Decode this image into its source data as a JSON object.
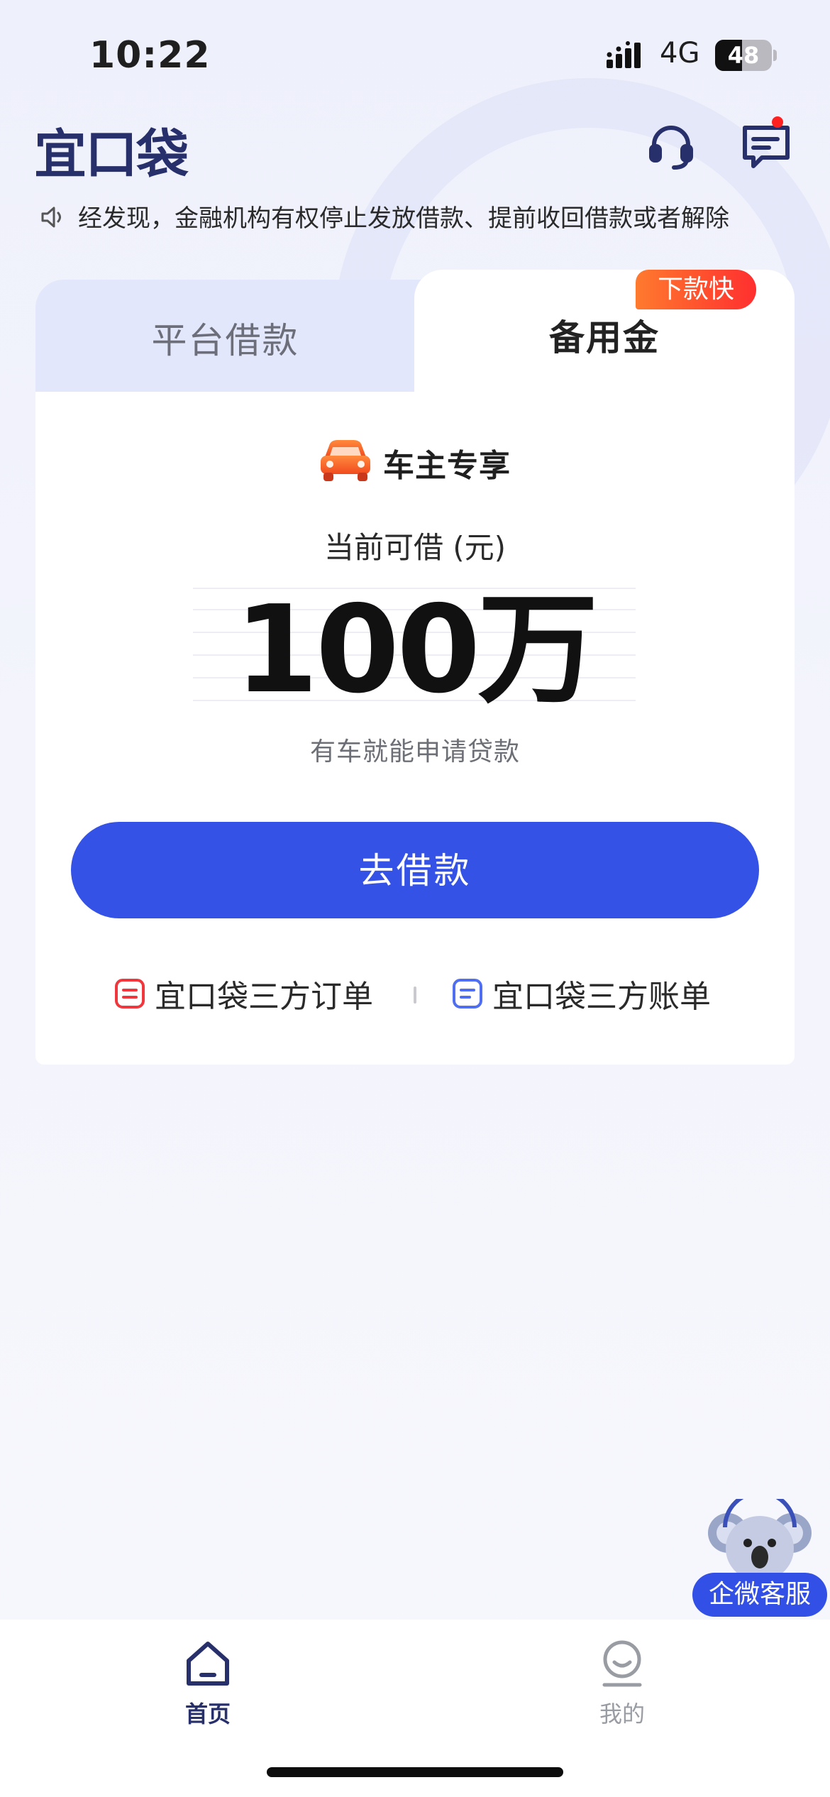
{
  "status_bar": {
    "time": "10:22",
    "network": "4G",
    "battery": "48",
    "battery_level": 0.48
  },
  "header": {
    "logo": "宜口袋",
    "icons": [
      "headset-icon",
      "message-icon"
    ],
    "has_unread": true
  },
  "notice": {
    "icon": "speaker-icon",
    "text": "经发现，金融机构有权停止发放借款、提前收回借款或者解除"
  },
  "tabs": [
    {
      "label": "平台借款",
      "active": false
    },
    {
      "label": "备用金",
      "active": true,
      "badge": "下款快"
    }
  ],
  "offer": {
    "icon": "car-icon",
    "title": "车主专享",
    "available_label": "当前可借 (元)",
    "amount": "100万",
    "subtitle": "有车就能申请贷款"
  },
  "cta": {
    "label": "去借款"
  },
  "links": [
    {
      "label": "宜口袋三方订单",
      "icon": "order-icon",
      "color": "#f0373d"
    },
    {
      "label": "宜口袋三方账单",
      "icon": "bill-icon",
      "color": "#4f6ef0"
    }
  ],
  "float_service": {
    "label": "企微客服",
    "icon": "koala-icon"
  },
  "tabbar": [
    {
      "label": "首页",
      "icon": "home-icon",
      "active": true
    },
    {
      "label": "我的",
      "icon": "profile-icon",
      "active": false
    }
  ],
  "colors": {
    "primary": "#3452e6",
    "brand_dark": "#27306a",
    "badge_start": "#ff7a2e",
    "badge_end": "#ff2f2f"
  }
}
